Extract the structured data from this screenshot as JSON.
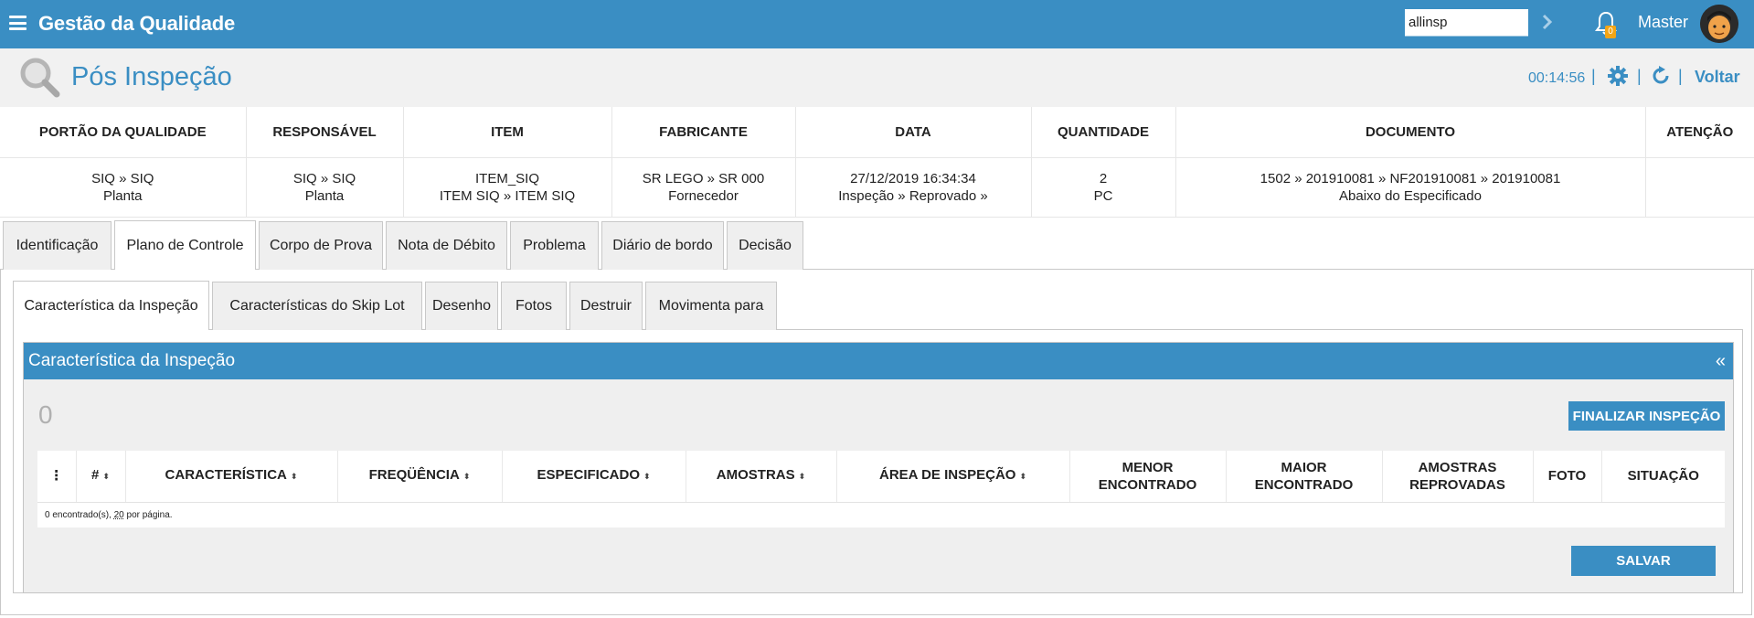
{
  "topbar": {
    "app_title": "Gestão da Qualidade",
    "search_value": "allinsp",
    "notification_count": "0",
    "user_name": "Master",
    "colors": {
      "bar": "#3a8ec3",
      "badge": "#f2a516"
    }
  },
  "header": {
    "title": "Pós Inspeção",
    "timer": "00:14:56",
    "separator": "|",
    "back_label": "Voltar"
  },
  "summary": {
    "headers": [
      "PORTÃO DA QUALIDADE",
      "RESPONSÁVEL",
      "ITEM",
      "FABRICANTE",
      "DATA",
      "QUANTIDADE",
      "DOCUMENTO",
      "ATENÇÃO"
    ],
    "row": [
      {
        "line1": "SIQ » SIQ",
        "line2": "Planta"
      },
      {
        "line1": "SIQ » SIQ",
        "line2": "Planta"
      },
      {
        "line1": "ITEM_SIQ",
        "line2": "ITEM SIQ » ITEM SIQ"
      },
      {
        "line1": "SR LEGO » SR 000",
        "line2": "Fornecedor"
      },
      {
        "line1": "27/12/2019 16:34:34",
        "line2": "Inspeção » Reprovado »"
      },
      {
        "line1": "2",
        "line2": "PC"
      },
      {
        "line1": "1502 » 201910081 » NF201910081 » 201910081",
        "line2": "Abaixo do Especificado"
      },
      {
        "line1": "",
        "line2": ""
      }
    ]
  },
  "tabs": [
    {
      "label": "Identificação"
    },
    {
      "label": "Plano de Controle"
    },
    {
      "label": "Corpo de Prova"
    },
    {
      "label": "Nota de Débito"
    },
    {
      "label": "Problema"
    },
    {
      "label": "Diário de bordo"
    },
    {
      "label": "Decisão"
    }
  ],
  "active_tab": "Plano de Controle",
  "subtabs": [
    {
      "label": "Característica da Inspeção"
    },
    {
      "label": "Características do Skip Lot"
    },
    {
      "label": "Desenho"
    },
    {
      "label": "Fotos"
    },
    {
      "label": "Destruir"
    },
    {
      "label": "Movimenta para"
    }
  ],
  "active_subtab": "Característica da Inspeção",
  "card": {
    "title": "Característica da Inspeção",
    "collapse_label": "«",
    "count": "0",
    "finalize_label": "FINALIZAR INSPEÇÃO",
    "save_label": "SALVAR"
  },
  "grid": {
    "columns": {
      "menu": "⋮",
      "number": "#",
      "characteristic": "CARACTERÍSTICA",
      "frequency": "FREQÜÊNCIA",
      "specified": "ESPECIFICADO",
      "samples": "AMOSTRAS",
      "inspection_area": "ÁREA DE INSPEÇÃO",
      "min_found_1": "MENOR",
      "min_found_2": "ENCONTRADO",
      "max_found_1": "MAIOR",
      "max_found_2": "ENCONTRADO",
      "rejected_1": "AMOSTRAS",
      "rejected_2": "REPROVADAS",
      "photo": "FOTO",
      "status": "SITUAÇÃO"
    },
    "sort_glyph": "⬍",
    "footer_prefix": "0 encontrado(s), ",
    "footer_per_page": "20",
    "footer_suffix": " por página."
  }
}
